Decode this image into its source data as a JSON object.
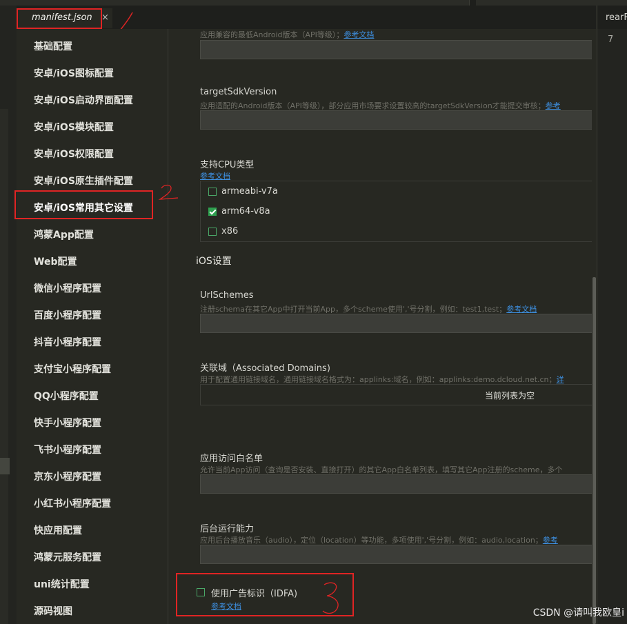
{
  "tab": {
    "label": "manifest.json",
    "close": "×"
  },
  "sidebar": {
    "items": [
      {
        "label": "基础配置"
      },
      {
        "label": "安卓/iOS图标配置"
      },
      {
        "label": "安卓/iOS启动界面配置"
      },
      {
        "label": "安卓/iOS模块配置"
      },
      {
        "label": "安卓/iOS权限配置"
      },
      {
        "label": "安卓/iOS原生插件配置"
      },
      {
        "label": "安卓/iOS常用其它设置"
      },
      {
        "label": "鸿蒙App配置"
      },
      {
        "label": "Web配置"
      },
      {
        "label": "微信小程序配置"
      },
      {
        "label": "百度小程序配置"
      },
      {
        "label": "抖音小程序配置"
      },
      {
        "label": "支付宝小程序配置"
      },
      {
        "label": "QQ小程序配置"
      },
      {
        "label": "快手小程序配置"
      },
      {
        "label": "飞书小程序配置"
      },
      {
        "label": "京东小程序配置"
      },
      {
        "label": "小红书小程序配置"
      },
      {
        "label": "快应用配置"
      },
      {
        "label": "鸿蒙元服务配置"
      },
      {
        "label": "uni统计配置"
      },
      {
        "label": "源码视图"
      }
    ],
    "active_index": 6
  },
  "content": {
    "min_sdk": {
      "desc": "应用兼容的最低Android版本（API等级）；",
      "link": "参考文档",
      "value": ""
    },
    "target_sdk": {
      "label": "targetSdkVersion",
      "desc": "应用适配的Android版本（API等级），部分应用市场要求设置较高的targetSdkVersion才能提交审核；",
      "link": "参考",
      "value": ""
    },
    "cpu": {
      "label": "支持CPU类型",
      "link": "参考文档",
      "options": [
        {
          "label": "armeabi-v7a",
          "checked": false
        },
        {
          "label": "arm64-v8a",
          "checked": true
        },
        {
          "label": "x86",
          "checked": false
        }
      ]
    },
    "ios_section": "iOS设置",
    "url_schemes": {
      "label": "UrlSchemes",
      "desc": "注册schema在其它App中打开当前App，多个scheme使用','号分割，例如：test1,test；",
      "link": "参考文档",
      "value": ""
    },
    "assoc_domains": {
      "label": "关联域（Associated Domains)",
      "desc": "用于配置通用链接域名，通用链接域名格式为：applinks:域名，例如：applinks:demo.dcloud.net.cn；",
      "link": "详",
      "empty": "当前列表为空"
    },
    "whitelist": {
      "label": "应用访问白名单",
      "desc": "允许当前App访问（查询是否安装、直接打开）的其它App白名单列表，填写其它App注册的scheme，多个",
      "value": ""
    },
    "background": {
      "label": "后台运行能力",
      "desc": "应用后台播放音乐（audio），定位（location）等功能，多项使用','号分割，例如：audio,location；",
      "link": "参考",
      "value": ""
    },
    "idfa": {
      "label": "使用广告标识（IDFA)",
      "link": "参考文档",
      "checked": false
    }
  },
  "annotations": {
    "mark1": "/",
    "mark2": "2",
    "mark3": "3",
    "color": "#e02424"
  },
  "right_pane": {
    "tab_label": "rearR",
    "line_number": "7"
  },
  "watermark": "CSDN @请叫我欧皇i",
  "colors": {
    "background": "#272822",
    "link": "#3d8fe0",
    "checkbox": "#2ea04f"
  }
}
